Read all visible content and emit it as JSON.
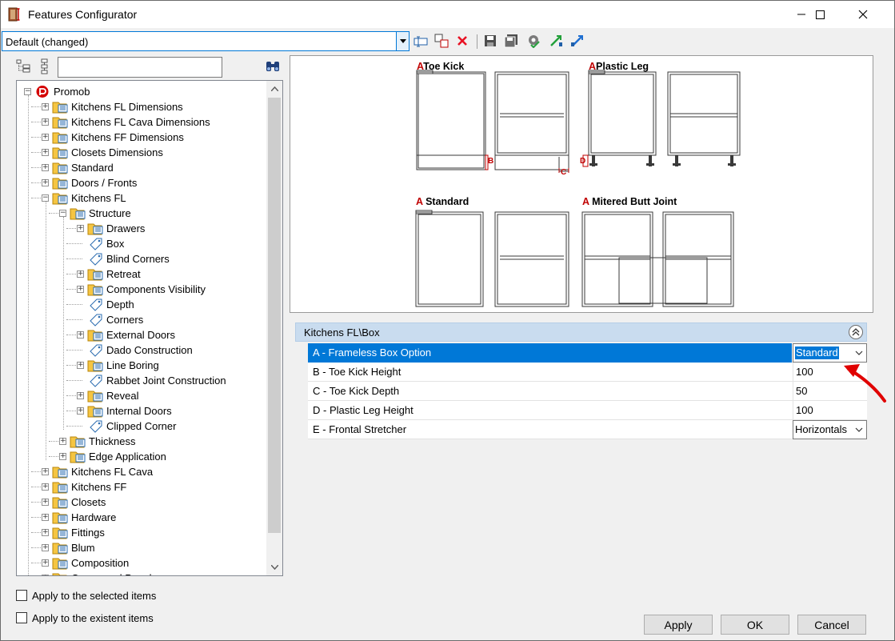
{
  "window": {
    "title": "Features Configurator",
    "minimize_icon": "minimize-icon",
    "maximize_icon": "maximize-icon",
    "close_icon": "close-icon"
  },
  "preset": {
    "selected": "Default (changed)"
  },
  "toolbar_icons": [
    "rename-icon",
    "copy-icon",
    "delete-icon",
    "save-icon",
    "save-as-icon",
    "settings-icon",
    "import-icon",
    "export-icon"
  ],
  "tree_search": {
    "value": ""
  },
  "tree": [
    {
      "label": "Promob",
      "level": 0,
      "expander": "−",
      "icon": "promob-logo-icon"
    },
    {
      "label": "Kitchens FL Dimensions",
      "level": 1,
      "expander": "+",
      "icon": "folder-icon"
    },
    {
      "label": "Kitchens FL Cava Dimensions",
      "level": 1,
      "expander": "+",
      "icon": "folder-icon"
    },
    {
      "label": "Kitchens FF Dimensions",
      "level": 1,
      "expander": "+",
      "icon": "folder-icon"
    },
    {
      "label": "Closets Dimensions",
      "level": 1,
      "expander": "+",
      "icon": "folder-icon"
    },
    {
      "label": "Standard",
      "level": 1,
      "expander": "+",
      "icon": "folder-icon"
    },
    {
      "label": "Doors / Fronts",
      "level": 1,
      "expander": "+",
      "icon": "folder-icon"
    },
    {
      "label": "Kitchens FL",
      "level": 1,
      "expander": "−",
      "icon": "folder-icon"
    },
    {
      "label": "Structure",
      "level": 2,
      "expander": "−",
      "icon": "folder-icon"
    },
    {
      "label": "Drawers",
      "level": 3,
      "expander": "+",
      "icon": "folder-icon"
    },
    {
      "label": "Box",
      "level": 3,
      "expander": "",
      "icon": "tag-icon",
      "selected": true
    },
    {
      "label": "Blind Corners",
      "level": 3,
      "expander": "",
      "icon": "tag-icon"
    },
    {
      "label": "Retreat",
      "level": 3,
      "expander": "+",
      "icon": "folder-icon"
    },
    {
      "label": "Components Visibility",
      "level": 3,
      "expander": "+",
      "icon": "folder-icon"
    },
    {
      "label": "Depth",
      "level": 3,
      "expander": "",
      "icon": "tag-icon"
    },
    {
      "label": "Corners",
      "level": 3,
      "expander": "",
      "icon": "tag-icon"
    },
    {
      "label": "External Doors",
      "level": 3,
      "expander": "+",
      "icon": "folder-icon"
    },
    {
      "label": "Dado Construction",
      "level": 3,
      "expander": "",
      "icon": "tag-icon"
    },
    {
      "label": "Line Boring",
      "level": 3,
      "expander": "+",
      "icon": "folder-icon"
    },
    {
      "label": "Rabbet Joint Construction",
      "level": 3,
      "expander": "",
      "icon": "tag-icon"
    },
    {
      "label": "Reveal",
      "level": 3,
      "expander": "+",
      "icon": "folder-icon"
    },
    {
      "label": "Internal Doors",
      "level": 3,
      "expander": "+",
      "icon": "folder-icon"
    },
    {
      "label": "Clipped Corner",
      "level": 3,
      "expander": "",
      "icon": "tag-icon"
    },
    {
      "label": "Thickness",
      "level": 2,
      "expander": "+",
      "icon": "folder-icon"
    },
    {
      "label": "Edge Application",
      "level": 2,
      "expander": "+",
      "icon": "folder-icon"
    },
    {
      "label": "Kitchens FL Cava",
      "level": 1,
      "expander": "+",
      "icon": "folder-icon"
    },
    {
      "label": "Kitchens FF",
      "level": 1,
      "expander": "+",
      "icon": "folder-icon"
    },
    {
      "label": "Closets",
      "level": 1,
      "expander": "+",
      "icon": "folder-icon"
    },
    {
      "label": "Hardware",
      "level": 1,
      "expander": "+",
      "icon": "folder-icon"
    },
    {
      "label": "Fittings",
      "level": 1,
      "expander": "+",
      "icon": "folder-icon"
    },
    {
      "label": "Blum",
      "level": 1,
      "expander": "+",
      "icon": "folder-icon"
    },
    {
      "label": "Composition",
      "level": 1,
      "expander": "+",
      "icon": "folder-icon"
    },
    {
      "label": "Compound Panel",
      "level": 1,
      "expander": "+",
      "icon": "folder-icon"
    }
  ],
  "options": {
    "apply_selected": "Apply to the selected items",
    "apply_existent": "Apply to the existent items"
  },
  "preview": {
    "labels": [
      {
        "prefix": "A",
        "text": "Toe Kick"
      },
      {
        "prefix": "A",
        "text": "Plastic Leg"
      },
      {
        "prefix": "A",
        "text": "Standard"
      },
      {
        "prefix": "A",
        "text": "Mitered Butt Joint"
      }
    ],
    "marks": [
      "B",
      "C",
      "D"
    ]
  },
  "properties": {
    "category": "Kitchens FL\\Box",
    "rows": [
      {
        "name": "A - Frameless Box Option",
        "value": "Standard",
        "type": "combo",
        "selected": true
      },
      {
        "name": "B - Toe Kick Height",
        "value": "100",
        "type": "text"
      },
      {
        "name": "C - Toe Kick Depth",
        "value": "50",
        "type": "text"
      },
      {
        "name": "D - Plastic Leg Height",
        "value": "100",
        "type": "text"
      },
      {
        "name": "E - Frontal Stretcher",
        "value": "Horizontals",
        "type": "combo"
      }
    ]
  },
  "buttons": {
    "apply": "Apply",
    "ok": "OK",
    "cancel": "Cancel"
  },
  "colors": {
    "selection": "#0078d7",
    "category_header": "#c9dcef",
    "annotation_arrow": "#e00000"
  }
}
